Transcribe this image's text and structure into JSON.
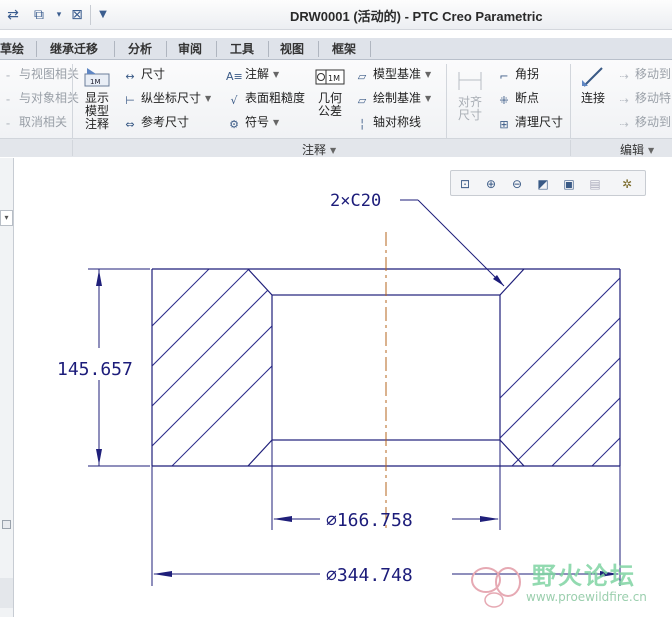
{
  "window": {
    "title": "DRW0001 (活动的) - PTC Creo Parametric"
  },
  "tabs": [
    "草绘",
    "继承迁移",
    "分析",
    "审阅",
    "工具",
    "视图",
    "框架"
  ],
  "ribbon": {
    "left_items": [
      "与视图相关",
      "与对象相关",
      "取消相关"
    ],
    "show_annotations": "显示模型注释",
    "dim_col": [
      "尺寸",
      "纵坐标尺寸",
      "参考尺寸"
    ],
    "note_col": [
      "注解",
      "表面粗糙度",
      "符号"
    ],
    "gtol": "几何公差",
    "datum_col": [
      "模型基准",
      "绘制基准",
      "轴对称线"
    ],
    "align": "对齐尺寸",
    "edit_col": [
      "角拐",
      "断点",
      "清理尺寸"
    ],
    "connect": "连接",
    "move_col": [
      "移动到",
      "移动特",
      "移动到"
    ],
    "group_annotate": "注释",
    "group_edit": "编辑"
  },
  "drawing": {
    "chamfer_note": "2×C20",
    "height_dim": "145.657",
    "inner_dia": "∅166.758",
    "outer_dia": "∅344.748"
  },
  "watermark": {
    "title": "野火论坛",
    "url": "www.proewildfire.cn"
  }
}
